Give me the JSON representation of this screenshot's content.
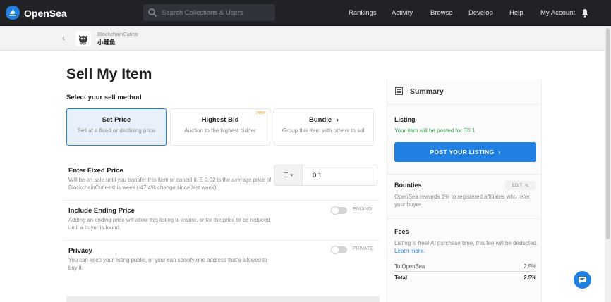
{
  "nav": {
    "brand": "OpenSea",
    "search_placeholder": "Search Collections & Users",
    "links": [
      "Rankings",
      "Activity",
      "Browse",
      "Develop",
      "Help",
      "My Account"
    ]
  },
  "item": {
    "collection": "BlockchainCuties",
    "name": "小鲤鱼"
  },
  "page": {
    "title": "Sell My Item",
    "method_label": "Select your sell method",
    "methods": [
      {
        "title": "Set Price",
        "subtitle": "Sell at a fixed or declining price"
      },
      {
        "title": "Highest Bid",
        "subtitle": "Auction to the highest bidder",
        "badge": "new"
      },
      {
        "title": "Bundle",
        "subtitle": "Group this item with others to sell"
      }
    ]
  },
  "form": {
    "fixed_price": {
      "title": "Enter Fixed Price",
      "desc": "Will be on sale until you transfer this item or cancel it. Ξ 0.02 is the average price of BlockchainCuties this week (-47.4% change since last week).",
      "currency": "Ξ",
      "value": "0.1"
    },
    "ending_price": {
      "title": "Include Ending Price",
      "desc": "Adding an ending price will allow this listing to expire, or for the price to be reduced until a buyer is found.",
      "toggle_label": "ENDING"
    },
    "privacy": {
      "title": "Privacy",
      "desc": "You can keep your listing public, or your can specify one address that's allowed to buy it.",
      "toggle_label": "PRIVATE"
    }
  },
  "summary": {
    "title": "Summary",
    "listing_label": "Listing",
    "listing_text": "Your item will be posted for Ξ0.1",
    "post_button": "POST YOUR LISTING",
    "bounties_label": "Bounties",
    "edit_label": "EDIT",
    "bounties_text": "OpenSea rewards 1% to registered affiliates who refer your buyer.",
    "fees_label": "Fees",
    "fees_text": "Listing is free! At purchase time, this fee will be deducted.",
    "learn_more": "Learn more.",
    "fees": [
      {
        "label": "To OpenSea",
        "value": "2.5%"
      },
      {
        "label": "Total",
        "value": "2.5%"
      }
    ]
  },
  "colors": {
    "accent": "#2081e2",
    "nav_bg": "#202225",
    "green": "#2fa34b"
  }
}
